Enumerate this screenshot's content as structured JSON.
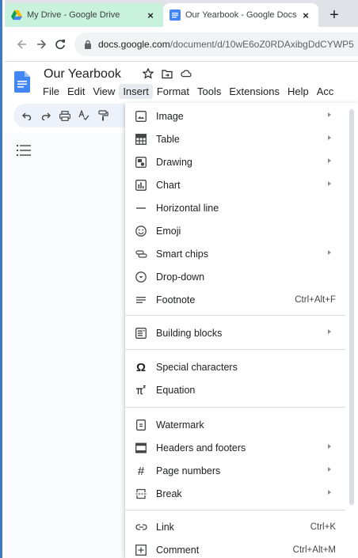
{
  "browser": {
    "tabs": [
      {
        "title": "My Drive - Google Drive",
        "active": false
      },
      {
        "title": "Our Yearbook - Google Docs",
        "active": true
      }
    ],
    "close_glyph": "×",
    "new_tab_glyph": "+",
    "url_host": "docs.google.com",
    "url_path": "/document/d/10wE6oZ0RDAxibgDdCYWP5"
  },
  "doc": {
    "title": "Our Yearbook"
  },
  "menubar": [
    "File",
    "Edit",
    "View",
    "Insert",
    "Format",
    "Tools",
    "Extensions",
    "Help",
    "Acc"
  ],
  "insert_menu": {
    "items": [
      {
        "label": "Image",
        "icon": "image-icon",
        "submenu": true
      },
      {
        "label": "Table",
        "icon": "table-icon",
        "submenu": true
      },
      {
        "label": "Drawing",
        "icon": "drawing-icon",
        "submenu": true
      },
      {
        "label": "Chart",
        "icon": "chart-icon",
        "submenu": true
      },
      {
        "label": "Horizontal line",
        "icon": "horizontal-line-icon",
        "submenu": false
      },
      {
        "label": "Emoji",
        "icon": "emoji-icon",
        "submenu": false
      },
      {
        "label": "Smart chips",
        "icon": "smart-chips-icon",
        "submenu": true
      },
      {
        "label": "Drop-down",
        "icon": "dropdown-icon",
        "submenu": false
      },
      {
        "label": "Footnote",
        "icon": "footnote-icon",
        "submenu": false,
        "shortcut": "Ctrl+Alt+F"
      },
      {
        "label": "Building blocks",
        "icon": "building-blocks-icon",
        "submenu": true
      },
      {
        "label": "Special characters",
        "icon": "omega-icon",
        "submenu": false
      },
      {
        "label": "Equation",
        "icon": "equation-icon",
        "submenu": false
      },
      {
        "label": "Watermark",
        "icon": "watermark-icon",
        "submenu": false
      },
      {
        "label": "Headers and footers",
        "icon": "headers-footers-icon",
        "submenu": true
      },
      {
        "label": "Page numbers",
        "icon": "hash-icon",
        "submenu": true
      },
      {
        "label": "Break",
        "icon": "break-icon",
        "submenu": true
      },
      {
        "label": "Link",
        "icon": "link-icon",
        "submenu": false,
        "shortcut": "Ctrl+K"
      },
      {
        "label": "Comment",
        "icon": "comment-icon",
        "submenu": false,
        "shortcut": "Ctrl+Alt+M"
      }
    ]
  },
  "colors": {
    "drive_tab_bg": "#c9f2dd",
    "docs_blue": "#4285f4",
    "menu_open_bg": "#e8eaed",
    "frame_accent": "#3c7ac4"
  }
}
